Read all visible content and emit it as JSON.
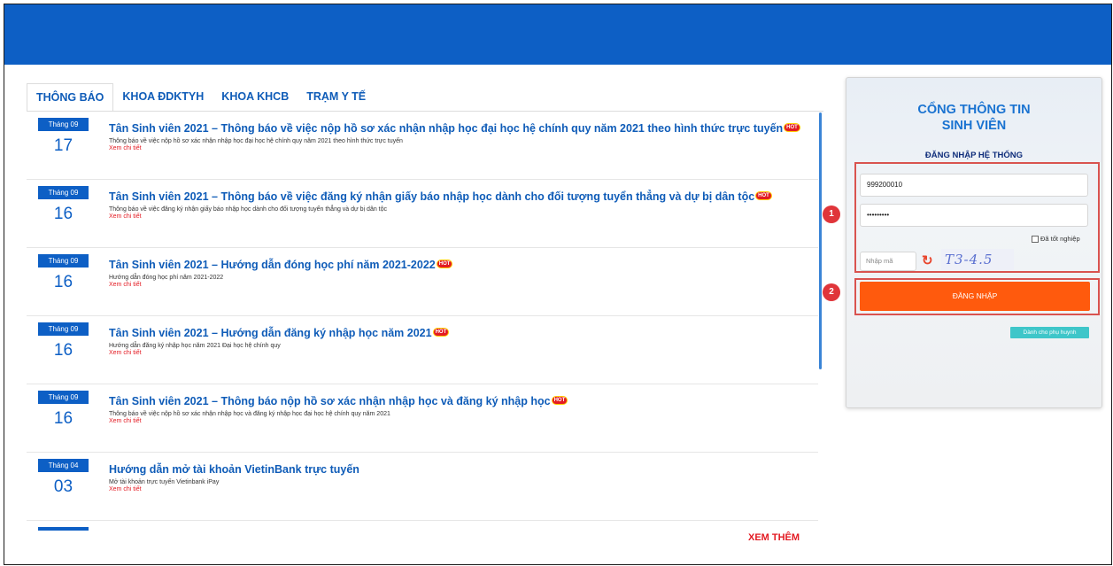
{
  "tabs": [
    "THÔNG BÁO",
    "KHOA ĐDKTYH",
    "KHOA KHCB",
    "TRẠM Y TẾ"
  ],
  "hot_label": "HOT",
  "news": [
    {
      "month": "Tháng 09",
      "day": "17",
      "title": "Tân Sinh viên 2021 – Thông báo về việc nộp hồ sơ xác nhận nhập học đại học hệ chính quy năm 2021 theo hình thức trực tuyến",
      "desc": "Thông báo về việc nộp hồ sơ xác nhận nhập học đại học hệ chính quy năm 2021 theo hình thức trực tuyến",
      "more": "Xem chi tiết"
    },
    {
      "month": "Tháng 09",
      "day": "16",
      "title": "Tân Sinh viên 2021 – Thông báo về việc đăng ký nhận giấy báo nhập học dành cho đối tượng tuyển thẳng và dự bị dân tộc",
      "desc": "Thông báo về việc đăng ký nhận giấy báo nhập học dành cho đối tượng tuyển thẳng và dự bị dân tộc",
      "more": "Xem chi tiết"
    },
    {
      "month": "Tháng 09",
      "day": "16",
      "title": "Tân Sinh viên 2021 – Hướng dẫn đóng học phí năm 2021-2022",
      "desc": "Hướng dẫn đóng học phí năm 2021-2022",
      "more": "Xem chi tiết"
    },
    {
      "month": "Tháng 09",
      "day": "16",
      "title": "Tân Sinh viên 2021 – Hướng dẫn đăng ký nhập học năm 2021",
      "desc": "Hướng dẫn đăng ký nhập học năm 2021 Đại học hệ chính quy",
      "more": "Xem chi tiết"
    },
    {
      "month": "Tháng 09",
      "day": "16",
      "title": "Tân Sinh viên 2021 – Thông báo nộp hồ sơ xác nhận nhập học và đăng ký nhập học",
      "desc": "Thông báo về việc nộp hồ sơ xác nhận nhập học và đăng ký nhập học đại học hệ chính quy năm 2021",
      "more": "Xem chi tiết"
    },
    {
      "month": "Tháng 04",
      "day": "03",
      "title": "Hướng dẫn mở tài khoản VietinBank trực tuyến",
      "desc": "Mở tài khoản trực tuyến Vietinbank iPay",
      "more": "Xem chi tiết"
    }
  ],
  "see_more": "XEM THÊM",
  "login": {
    "portal_line1": "CỔNG THÔNG TIN",
    "portal_line2": "SINH VIÊN",
    "subtitle": "ĐĂNG NHẬP HỆ THỐNG",
    "username": "999200010",
    "password": "•••••••••",
    "graduated_label": "Đã tốt nghiệp",
    "captcha_placeholder": "Nhập mã",
    "captcha_text": "T3-4.5",
    "login_button": "ĐĂNG NHẬP",
    "parent_button": "Dành cho phụ huynh"
  },
  "annotations": [
    "1",
    "2"
  ],
  "colors": {
    "primary": "#0d5fc5",
    "accent": "#ff5a0d",
    "hot": "#e31b23",
    "teal": "#3ec6c9"
  }
}
